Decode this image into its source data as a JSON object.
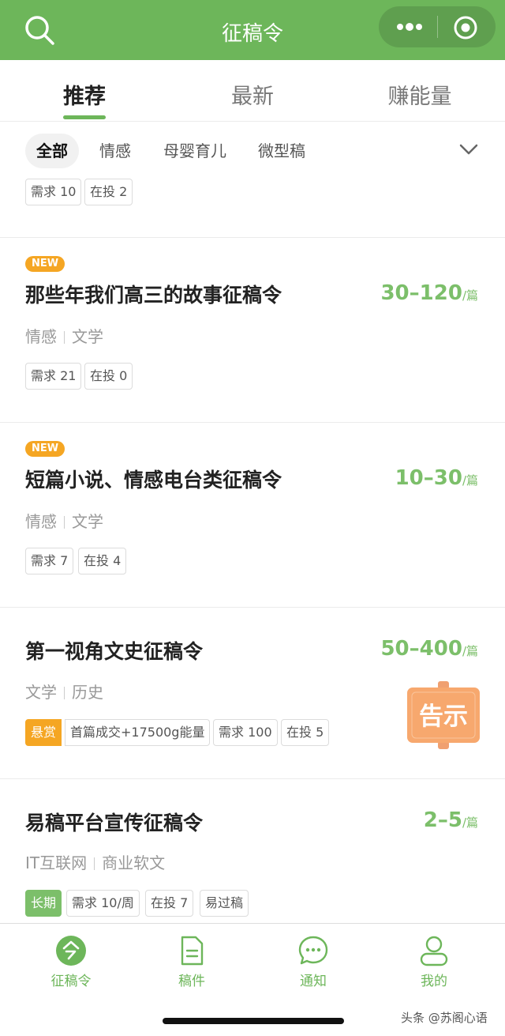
{
  "header": {
    "title": "征稿令",
    "icons": [
      "search-icon",
      "more-dots-icon",
      "target-icon"
    ],
    "color": "#6db65a"
  },
  "tabs": [
    {
      "label": "推荐",
      "active": true
    },
    {
      "label": "最新",
      "active": false
    },
    {
      "label": "赚能量",
      "active": false
    }
  ],
  "filters": {
    "chips": [
      {
        "label": "全部",
        "active": true
      },
      {
        "label": "情感",
        "active": false
      },
      {
        "label": "母婴育儿",
        "active": false
      },
      {
        "label": "微型稿",
        "active": false
      }
    ],
    "expand_icon": "chevron-down-icon"
  },
  "partial_card": {
    "tags": [
      "需求 10",
      "在投 2"
    ]
  },
  "cards": [
    {
      "badge": "NEW",
      "title": "那些年我们高三的故事征稿令",
      "price": "30–120",
      "unit": "/篇",
      "categories": [
        "情感",
        "文学"
      ],
      "tags": [
        "需求 21",
        "在投 0"
      ]
    },
    {
      "badge": "NEW",
      "title": "短篇小说、情感电台类征稿令",
      "price": "10–30",
      "unit": "/篇",
      "categories": [
        "情感",
        "文学"
      ],
      "tags": [
        "需求 7",
        "在投 4"
      ]
    },
    {
      "title": "第一视角文史征稿令",
      "price": "50–400",
      "unit": "/篇",
      "categories": [
        "文学",
        "历史"
      ],
      "reward_label": "悬赏",
      "reward_text": "首篇成交+17500g能量",
      "tags": [
        "需求 100",
        "在投 5"
      ],
      "notice_label": "告示"
    },
    {
      "title": "易稿平台宣传征稿令",
      "price": "2–5",
      "unit": "/篇",
      "categories": [
        "IT互联网",
        "商业软文"
      ],
      "highlight_tag": "长期",
      "tags": [
        "需求 10/周",
        "在投 7",
        "易过稿"
      ]
    }
  ],
  "bottom_nav": [
    {
      "label": "征稿令",
      "icon": "order-icon",
      "active": true
    },
    {
      "label": "稿件",
      "icon": "document-icon",
      "active": false
    },
    {
      "label": "通知",
      "icon": "chat-bubble-icon",
      "active": false
    },
    {
      "label": "我的",
      "icon": "user-icon",
      "active": false
    }
  ],
  "watermark": "头条 @苏阁心语"
}
